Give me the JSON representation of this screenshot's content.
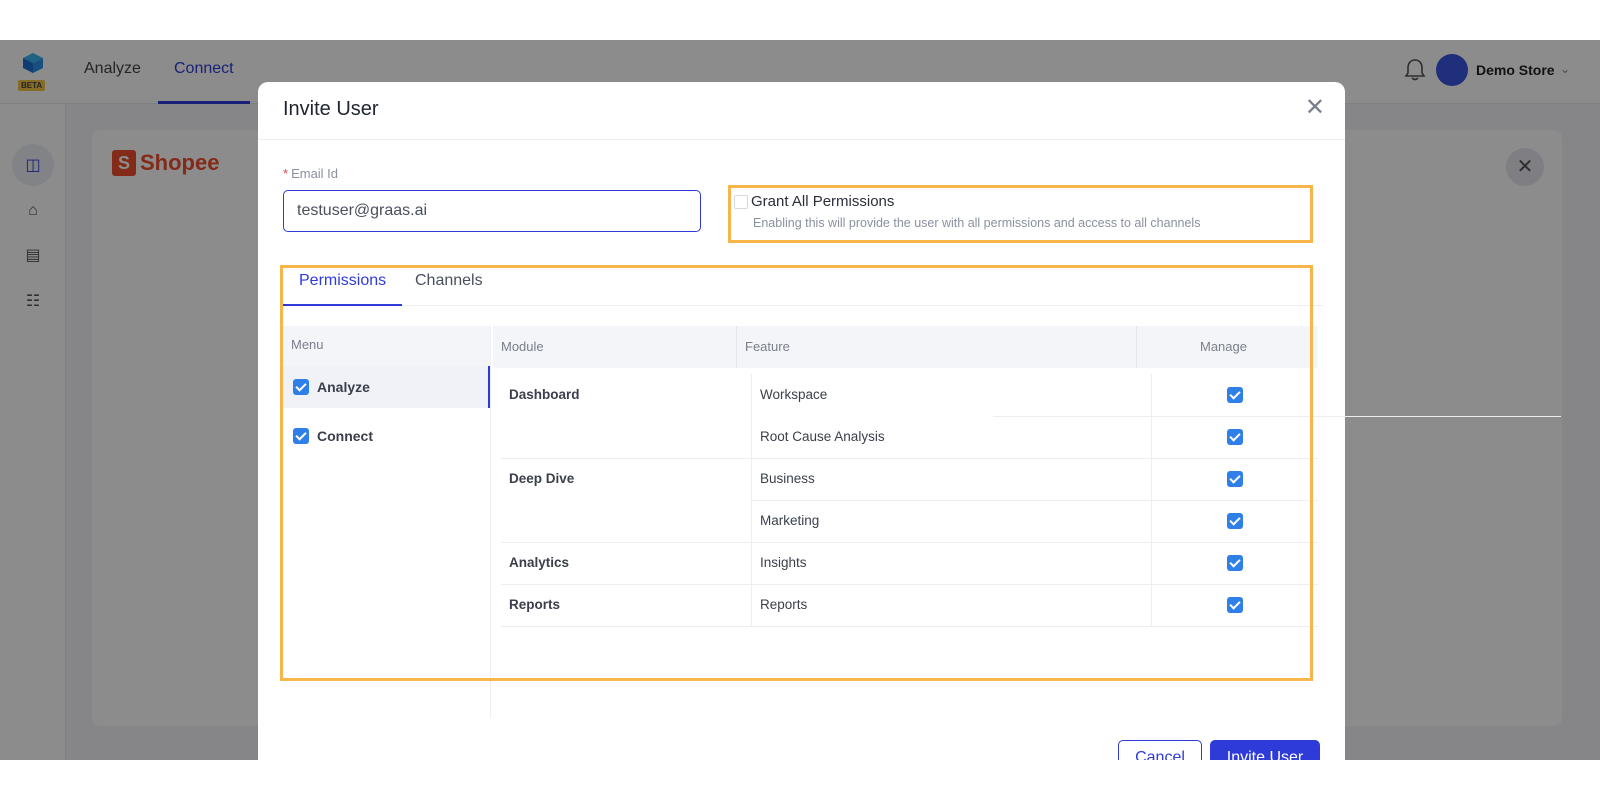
{
  "app": {
    "badge": "BETA",
    "nav": [
      {
        "label": "Analyze",
        "active": false
      },
      {
        "label": "Connect",
        "active": true
      }
    ],
    "user": {
      "store_name": "Demo Store"
    }
  },
  "background": {
    "brand": "Shopee"
  },
  "modal": {
    "title": "Invite User",
    "email": {
      "required_mark": "*",
      "label": "Email Id",
      "value": "testuser@graas.ai"
    },
    "grant_all": {
      "title": "Grant All Permissions",
      "description": "Enabling this will provide the user with all permissions and access to all channels",
      "checked": false
    },
    "tabs": [
      {
        "label": "Permissions",
        "active": true
      },
      {
        "label": "Channels",
        "active": false
      }
    ],
    "menu": {
      "header": "Menu",
      "items": [
        {
          "label": "Analyze",
          "checked": true,
          "selected": true
        },
        {
          "label": "Connect",
          "checked": true,
          "selected": false
        }
      ]
    },
    "table": {
      "headers": {
        "module": "Module",
        "feature": "Feature",
        "manage": "Manage"
      },
      "rows": [
        {
          "module": "Dashboard",
          "feature": "Workspace",
          "manage": true
        },
        {
          "module": "",
          "feature": "Root Cause Analysis",
          "manage": true
        },
        {
          "module": "Deep Dive",
          "feature": "Business",
          "manage": true
        },
        {
          "module": "",
          "feature": "Marketing",
          "manage": true
        },
        {
          "module": "Analytics",
          "feature": "Insights",
          "manage": true
        },
        {
          "module": "Reports",
          "feature": "Reports",
          "manage": true
        }
      ]
    },
    "buttons": {
      "cancel": "Cancel",
      "invite": "Invite User"
    }
  },
  "colors": {
    "primary": "#2e3bd9",
    "checkbox": "#2f7fe8",
    "highlight": "#f7b54a",
    "shopee": "#ee4d2d"
  }
}
